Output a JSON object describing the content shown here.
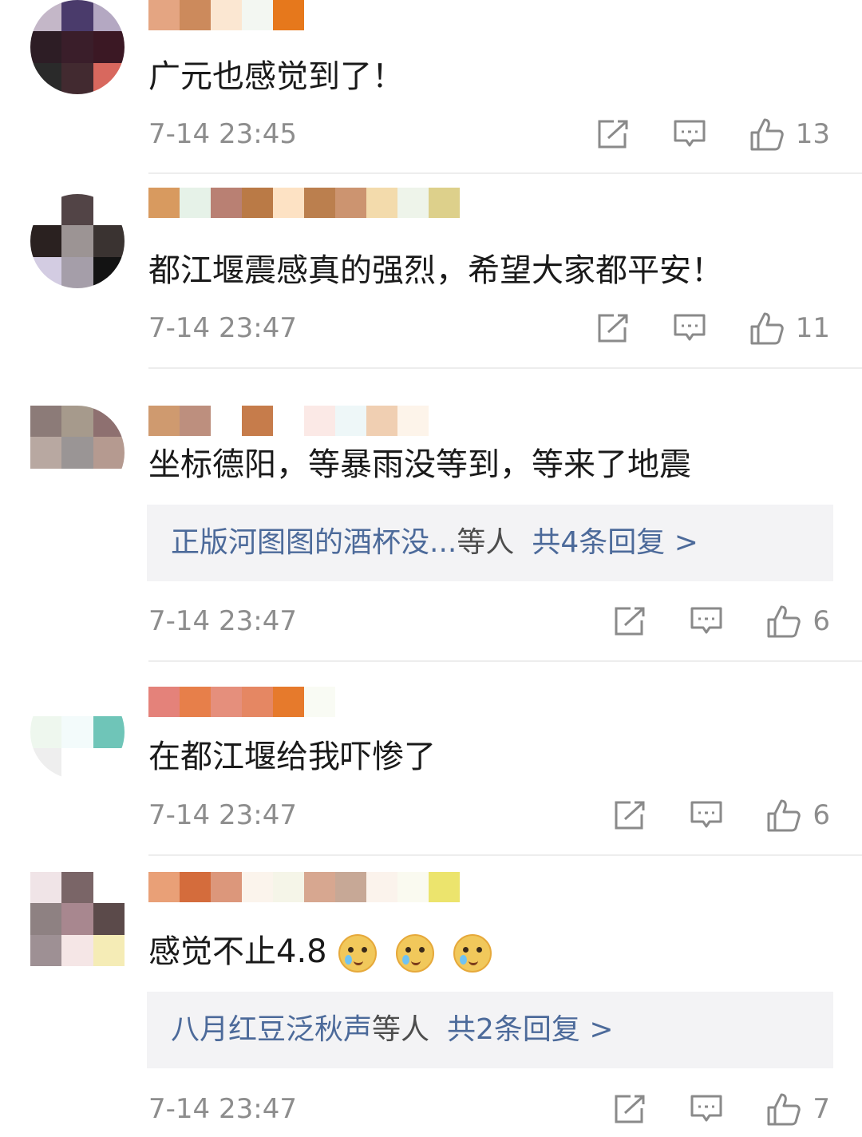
{
  "comments": [
    {
      "avatar_colors": [
        "#c4b7c8",
        "#4a3b6b",
        "#b4a8c2",
        "#2d1d25",
        "#3a1e2a",
        "#3b1824",
        "#2a2a2a",
        "#422a30",
        "#d8685e"
      ],
      "name_colors": [
        "#e4a582",
        "#cc8a5c",
        "#fbe7d2",
        "#f3f7f2",
        "#e6781c",
        "#ffffff"
      ],
      "text": "广元也感觉到了！",
      "time": "7-14 23:45",
      "likes": "13"
    },
    {
      "avatar_colors": [
        "#ffffff",
        "#524446",
        "#ffffff",
        "#2a2120",
        "#9c9494",
        "#3a3331",
        "#d3cce2",
        "#a59ea9",
        "#131313"
      ],
      "name_colors": [
        "#d89a5f",
        "#e6f2e8",
        "#b98073",
        "#ba7a46",
        "#fde2c4",
        "#bb7f4e",
        "#cc9470",
        "#f3dbac",
        "#eef4ea",
        "#ddd08b"
      ],
      "text": "都江堰震感真的强烈，希望大家都平安！",
      "time": "7-14 23:47",
      "likes": "11"
    },
    {
      "avatar_colors": [
        "#8c7b78",
        "#a69a8c",
        "#8e7070",
        "#b8a8a1",
        "#9a9595",
        "#b59a90",
        "#ffffff",
        "#ffffff",
        "#ffffff"
      ],
      "name_colors": [
        "#cf9a6f",
        "#bd8f7e",
        "#ffffff",
        "#c67c4b",
        "#ffffff",
        "#fbe9e6",
        "#eef7f8",
        "#f0cfb2",
        "#fdf4ea"
      ],
      "text": "坐标德阳，等暴雨没等到，等来了地震",
      "replies": {
        "who": "正版河图图的酒杯没...",
        "mid": "等人",
        "count": "共4条回复 >"
      },
      "time": "7-14 23:47",
      "likes": "6"
    },
    {
      "avatar_colors": [
        "#ffffff",
        "#ffffff",
        "#ffffff",
        "#eef7ee",
        "#f3fbfb",
        "#6fc5b8",
        "#eeeeee",
        "#ffffff",
        "#ffffff"
      ],
      "name_colors": [
        "#e4827a",
        "#e77f4a",
        "#e58f7c",
        "#e58763",
        "#e67a2c",
        "#f9fbf4"
      ],
      "text": "在都江堰给我吓惨了",
      "time": "7-14 23:47",
      "likes": "6"
    },
    {
      "avatar_colors": [
        "#f0e4e7",
        "#7a6567",
        "#ffffff",
        "#8e8182",
        "#a8878f",
        "#5b4a4a",
        "#9e9094",
        "#f5e6e6",
        "#f5ecb6"
      ],
      "name_colors": [
        "#e9a077",
        "#d46c3c",
        "#dc977b",
        "#fbf4ec",
        "#f5f5e8",
        "#d7a790",
        "#c7a896",
        "#fbf3ec",
        "#fafaf0",
        "#ece46d"
      ],
      "text": "感觉不止4.8",
      "emoji_count": 3,
      "replies": {
        "who": "八月红豆泛秋声",
        "mid": "等人",
        "count": "共2条回复 >"
      },
      "time": "7-14 23:47",
      "likes": "7"
    }
  ]
}
